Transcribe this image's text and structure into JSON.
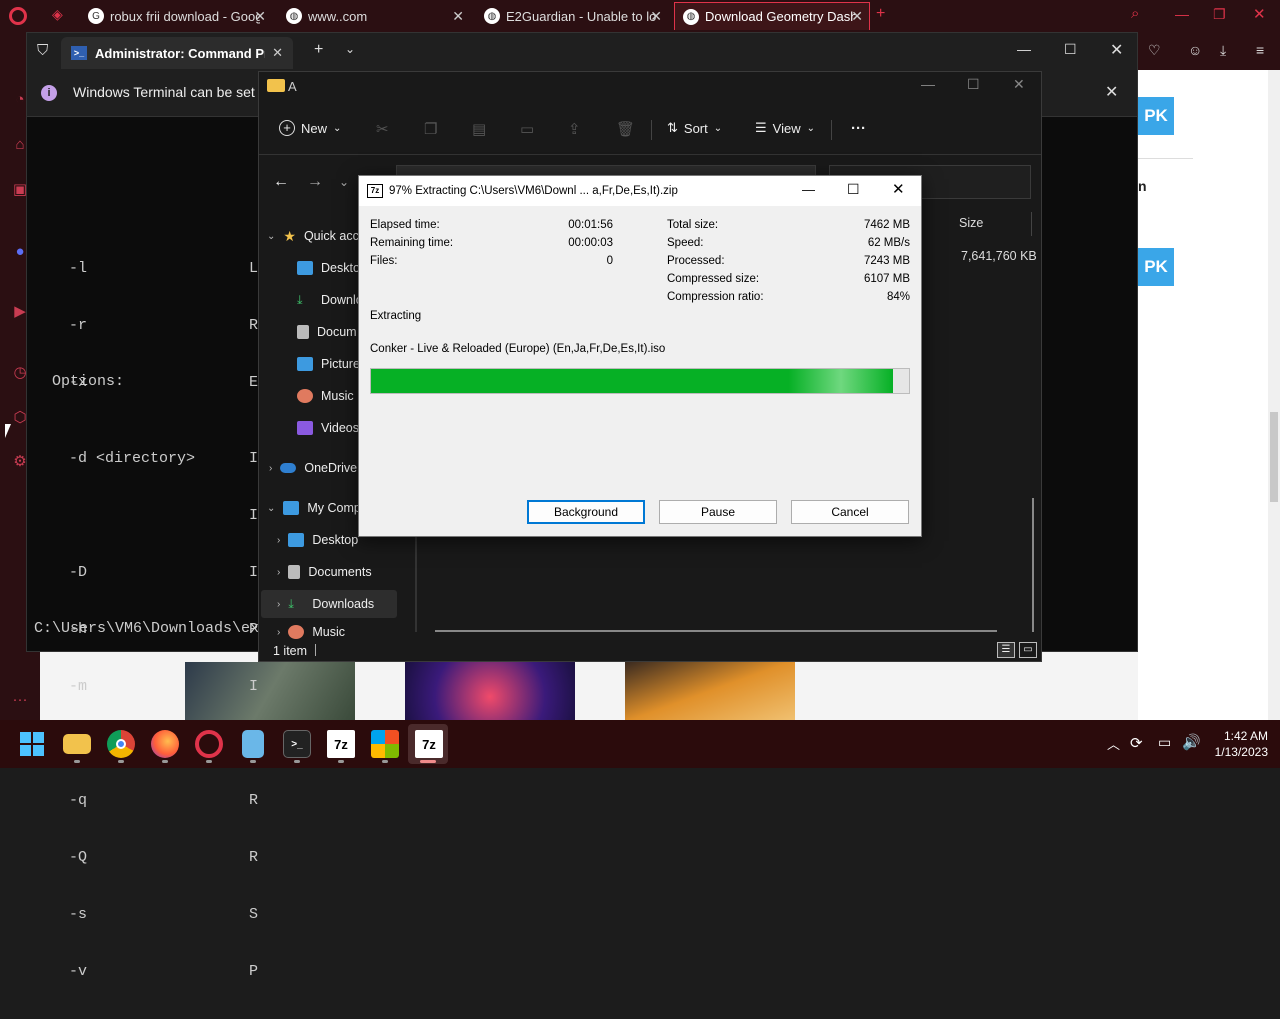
{
  "browser": {
    "tabs": [
      {
        "title": "robux frii download - Goog"
      },
      {
        "title": "www..com"
      },
      {
        "title": "E2Guardian - Unable to loa"
      },
      {
        "title": "Download Geometry Dash"
      }
    ],
    "apk_label": "PK",
    "side_text": "n"
  },
  "terminal": {
    "tab_title": "Administrator:  Command Pro",
    "info_text": "Windows Terminal can be set a",
    "lines_top": [
      "-l",
      "-r",
      "-x"
    ],
    "lines_top_right": [
      "L",
      "R",
      "E"
    ],
    "options_header": "Options:",
    "option_lines": [
      "-d <directory>",
      "",
      "-D",
      "-h",
      "-m",
      "",
      "-q",
      "-Q",
      "-s",
      "-v"
    ],
    "option_right": [
      "I",
      "I",
      "I",
      "P",
      "I",
      "",
      "R",
      "R",
      "S",
      "P"
    ],
    "prompt": "C:\\Users\\VM6\\Downloads\\ex"
  },
  "explorer": {
    "title": "A",
    "new_label": "New",
    "sort_label": "Sort",
    "view_label": "View",
    "more_label": "···",
    "size_header": "Size",
    "file_size": "7,641,760 KB",
    "nav": {
      "quick_access": "Quick acc",
      "desktop": "Desktop",
      "downloads": "Downlo",
      "documents": "Docum",
      "pictures": "Pictures",
      "music": "Music",
      "videos": "Videos",
      "onedrive": "OneDrive",
      "my_computer": "My Comp",
      "desktop2": "Desktop",
      "documents2": "Documents",
      "downloads2": "Downloads",
      "music2": "Music"
    },
    "status": "1 item"
  },
  "zip": {
    "title": "97% Extracting C:\\Users\\VM6\\Downl ... a,Fr,De,Es,It).zip",
    "elapsed_label": "Elapsed time:",
    "elapsed_value": "00:01:56",
    "remaining_label": "Remaining time:",
    "remaining_value": "00:00:03",
    "files_label": "Files:",
    "files_value": "0",
    "total_label": "Total size:",
    "total_value": "7462 MB",
    "speed_label": "Speed:",
    "speed_value": "62 MB/s",
    "processed_label": "Processed:",
    "processed_value": "7243 MB",
    "compressed_label": "Compressed size:",
    "compressed_value": "6107 MB",
    "ratio_label": "Compression ratio:",
    "ratio_value": "84%",
    "status": "Extracting",
    "current_file": "Conker - Live & Reloaded (Europe) (En,Ja,Fr,De,Es,It).iso",
    "progress": 0.97,
    "background_label": "Background",
    "pause_label": "Pause",
    "cancel_label": "Cancel"
  },
  "taskbar": {
    "time": "1:42 AM",
    "date": "1/13/2023",
    "seven_zip_label": "7z"
  },
  "colors": {
    "opera_red": "#c93c52",
    "progress_green": "#06b025",
    "apk_blue": "#3aa6e8"
  }
}
